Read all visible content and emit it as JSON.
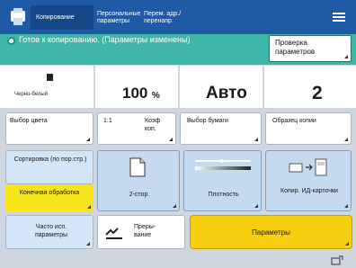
{
  "topbar": {
    "tabs": [
      {
        "label": "Копирование"
      },
      {
        "label": "Персональные параметры"
      },
      {
        "label": "Перем. адр./перенапр."
      }
    ]
  },
  "status": {
    "text": "Готов к копированию. (Параметры изменены)",
    "check_button": "Проверка параметров"
  },
  "info": {
    "color_mode": "Черно-белый",
    "zoom_value": "100",
    "zoom_unit": "%",
    "paper": "Авто",
    "copies": "2"
  },
  "row1": {
    "color_select": "Выбор цвета",
    "ratio_11": "1:1",
    "ratio_coef": "Коэф коп.",
    "paper_select": "Выбор бумаги",
    "sample_copy": "Образец копии"
  },
  "row2": {
    "sort": "Сортировка (по пор.стр.)",
    "finishing": "Конечная обработка",
    "duplex": "2-стор.",
    "density": "Плотность",
    "id_card": "Копир. ИД-карточки"
  },
  "row3": {
    "frequent": "Часто исп. параметры",
    "interrupt": "Преры-вание",
    "params": "Параметры"
  }
}
